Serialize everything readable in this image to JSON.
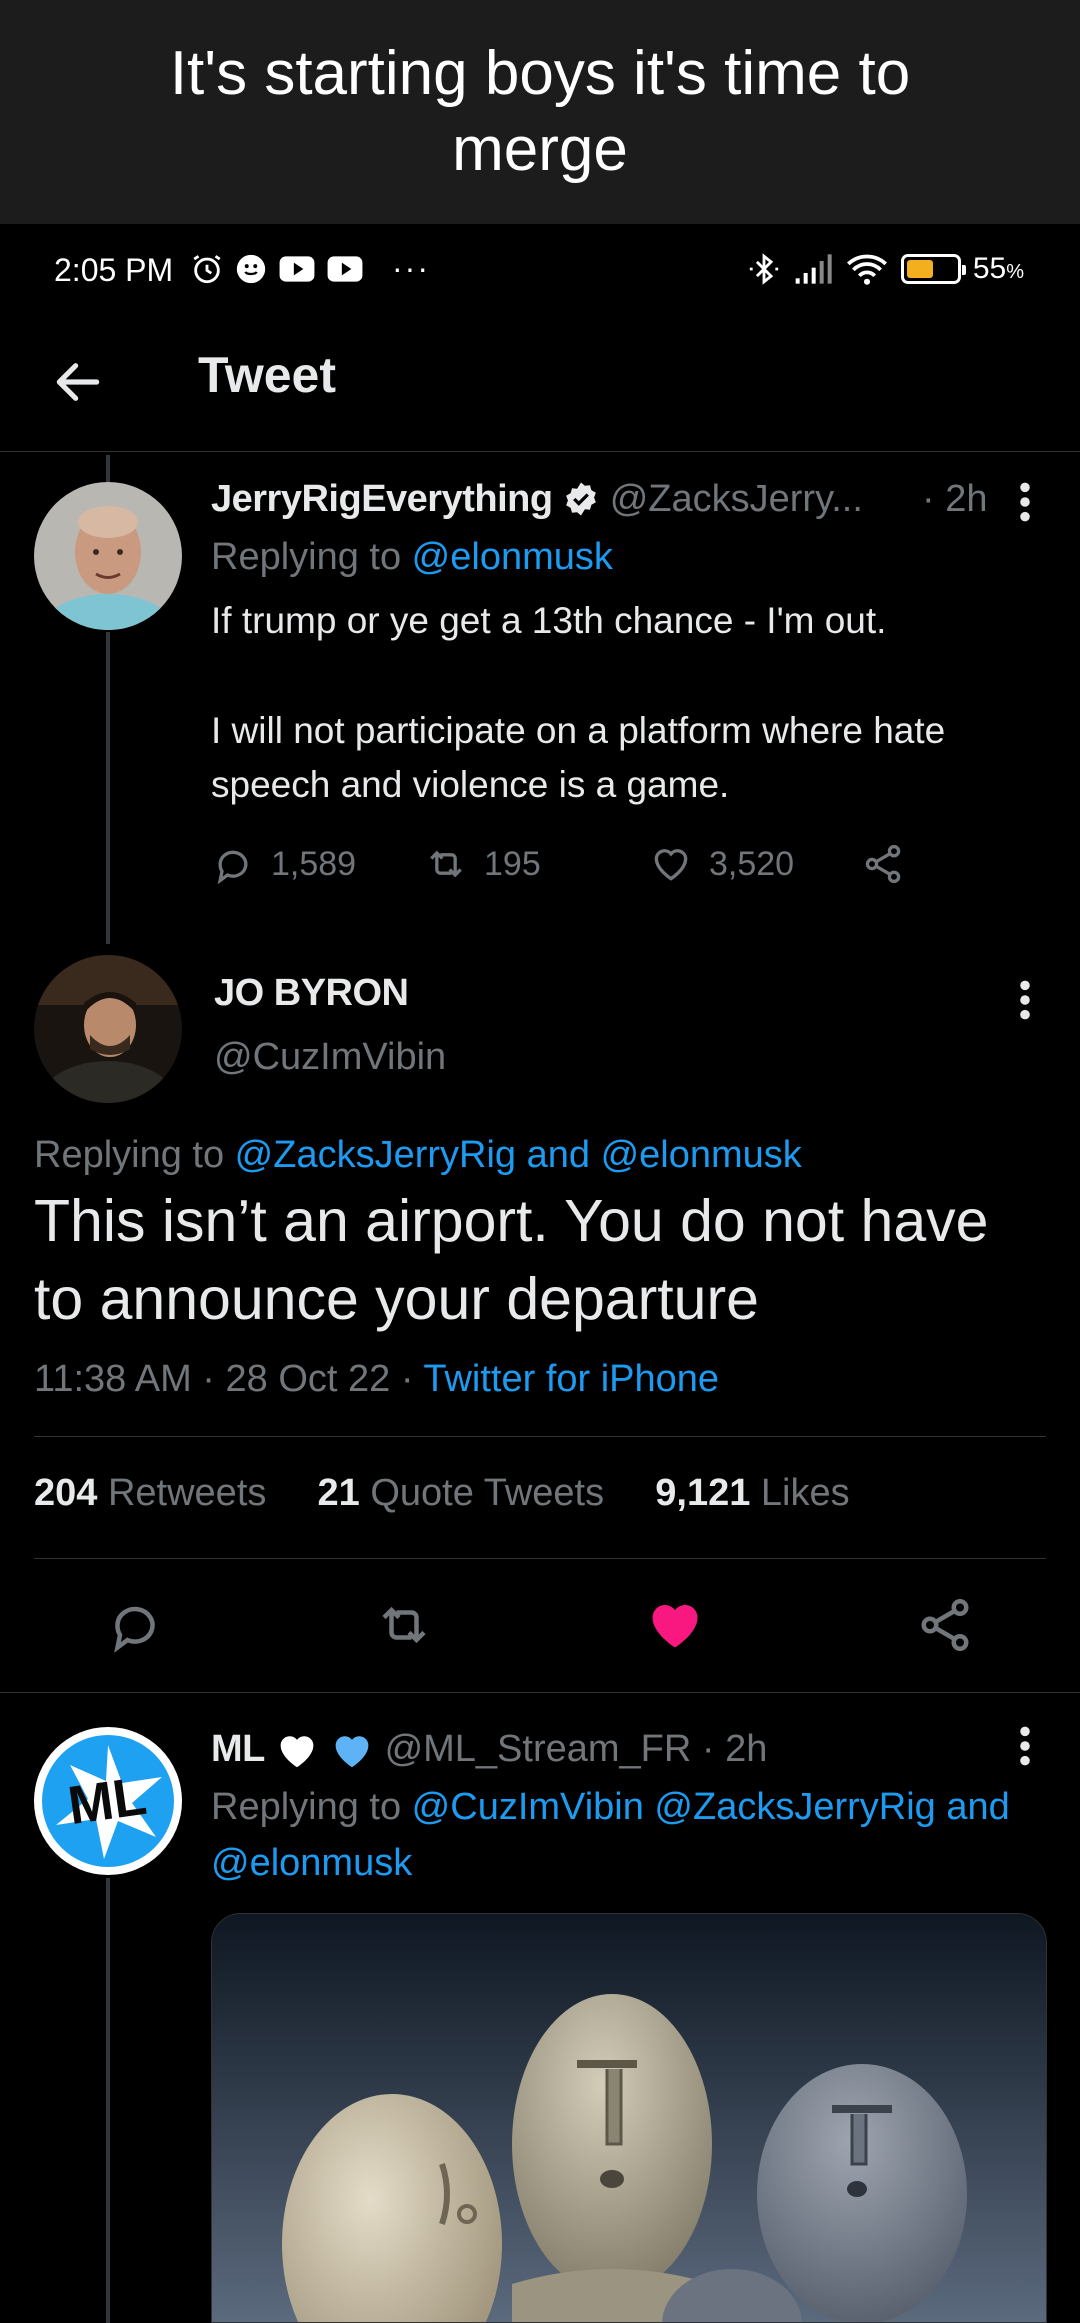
{
  "caption": {
    "text": "It's starting boys it's time to merge"
  },
  "status_bar": {
    "time": "2:05 PM",
    "more": "···",
    "battery_level": 0.55,
    "battery_percent": "55",
    "battery_unit": "%",
    "battery_color": "#f2b01e"
  },
  "header": {
    "title": "Tweet"
  },
  "parent_tweet": {
    "name": "JerryRigEverything",
    "handle": "@ZacksJerry...",
    "time": "· 2h",
    "replying_prefix": "Replying to ",
    "replying_to": "@elonmusk",
    "text_line1": "If trump or ye get a 13th chance - I'm out.",
    "text_line2": "I will not participate on a platform where hate speech and violence is a game.",
    "replies": "1,589",
    "retweets": "195",
    "likes": "3,520"
  },
  "main_tweet": {
    "name": "JO BYRON",
    "handle": "@CuzImVibin",
    "replying_prefix": "Replying to ",
    "replying_to": "@ZacksJerryRig and @elonmusk",
    "text": "This isn’t an airport. You do not have to announce your departure",
    "timestamp": "11:38 AM · 28 Oct 22 · ",
    "source": "Twitter for iPhone",
    "stats": {
      "retweets_count": "204",
      "retweets_label": "Retweets",
      "quotes_count": "21",
      "quotes_label": "Quote Tweets",
      "likes_count": "9,121",
      "likes_label": "Likes"
    },
    "liked": true,
    "like_color": "#f91880"
  },
  "reply_tweet": {
    "name": "ML",
    "handle": "@ML_Stream_FR",
    "time": "· 2h",
    "replying_prefix": "Replying to ",
    "replying_to_line1": "@CuzImVibin @ZacksJerryRig and",
    "replying_to_line2": "@elonmusk",
    "avatar_text": "ML"
  },
  "colors": {
    "accent": "#1d9bf0",
    "muted": "#71767b",
    "verified": "#e7e9ea"
  }
}
